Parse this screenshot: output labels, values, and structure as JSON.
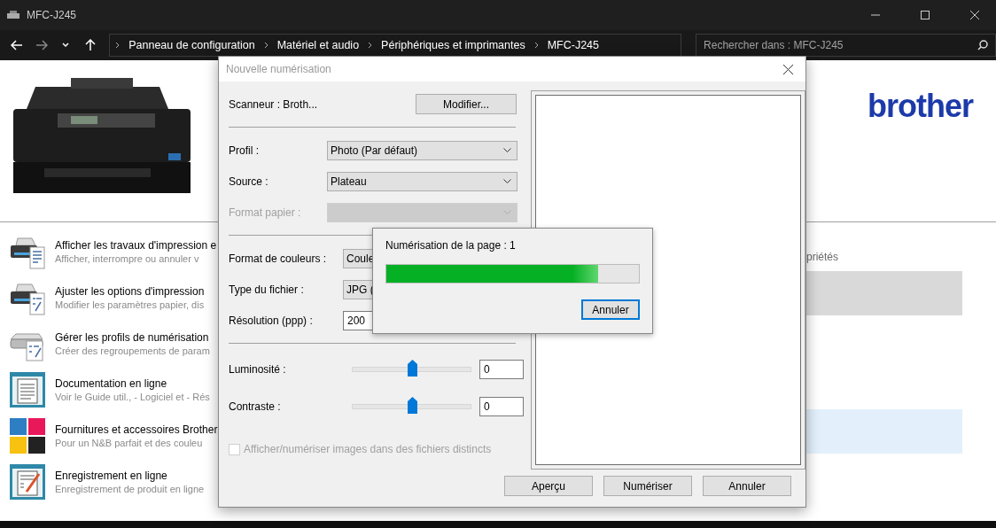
{
  "window": {
    "title": "MFC-J245"
  },
  "address_bar": {
    "breadcrumbs": [
      "Panneau de configuration",
      "Matériel et audio",
      "Périphériques et imprimantes",
      "MFC-J245"
    ],
    "search_placeholder": "Rechercher dans : MFC-J245"
  },
  "header": {
    "logo": "brother"
  },
  "tasks": [
    {
      "kind": "printer-doc",
      "title": "Afficher les travaux d'impression e",
      "subtitle": "Afficher, interrompre ou annuler v"
    },
    {
      "kind": "printer-form",
      "title": "Ajuster les options d'impression",
      "subtitle": "Modifier les paramètres papier, dis"
    },
    {
      "kind": "scanner-form",
      "title": "Gérer les profils de numérisation",
      "subtitle": "Créer des regroupements de param"
    },
    {
      "kind": "document",
      "title": "Documentation en ligne",
      "subtitle": "Voir le Guide util., - Logiciel et - Rés"
    },
    {
      "kind": "ink",
      "title": "Fournitures et accessoires Brother",
      "subtitle": "Pour un N&B parfait et des couleu"
    },
    {
      "kind": "register",
      "title": "Enregistrement en ligne",
      "subtitle": "Enregistrement de produit en ligne"
    }
  ],
  "side_panel": {
    "text": "priétés"
  },
  "dialog": {
    "title": "Nouvelle numérisation",
    "scanner_label": "Scanneur : Broth...",
    "modify_button": "Modifier...",
    "field_groups": [
      [
        {
          "kind": "select",
          "label": "Profil :",
          "value": "Photo (Par défaut)",
          "disabled": false
        },
        {
          "kind": "select",
          "label": "Source :",
          "value": "Plateau",
          "disabled": false
        },
        {
          "kind": "select",
          "label": "Format papier :",
          "disabled": true
        }
      ],
      [
        {
          "kind": "select",
          "label": "Format de couleurs :",
          "value": "Coule",
          "disabled": false
        },
        {
          "kind": "select",
          "label": "Type du fichier :",
          "value": "JPG (",
          "disabled": false
        },
        {
          "kind": "input",
          "label": "Résolution (ppp) :",
          "value": "200",
          "disabled": false
        }
      ]
    ],
    "sliders": [
      {
        "label": "Luminosité :",
        "level": 0.5,
        "value": "0"
      },
      {
        "label": "Contraste :",
        "level": 0.5,
        "value": "0"
      }
    ],
    "checkbox": {
      "label": "Afficher/numériser images dans des fichiers distincts",
      "checked": false,
      "disabled": true
    },
    "buttons": [
      "Aperçu",
      "Numériser",
      "Annuler"
    ]
  },
  "progress": {
    "message": "Numérisation de la page : 1",
    "level": 0.84,
    "button": "Annuler"
  }
}
